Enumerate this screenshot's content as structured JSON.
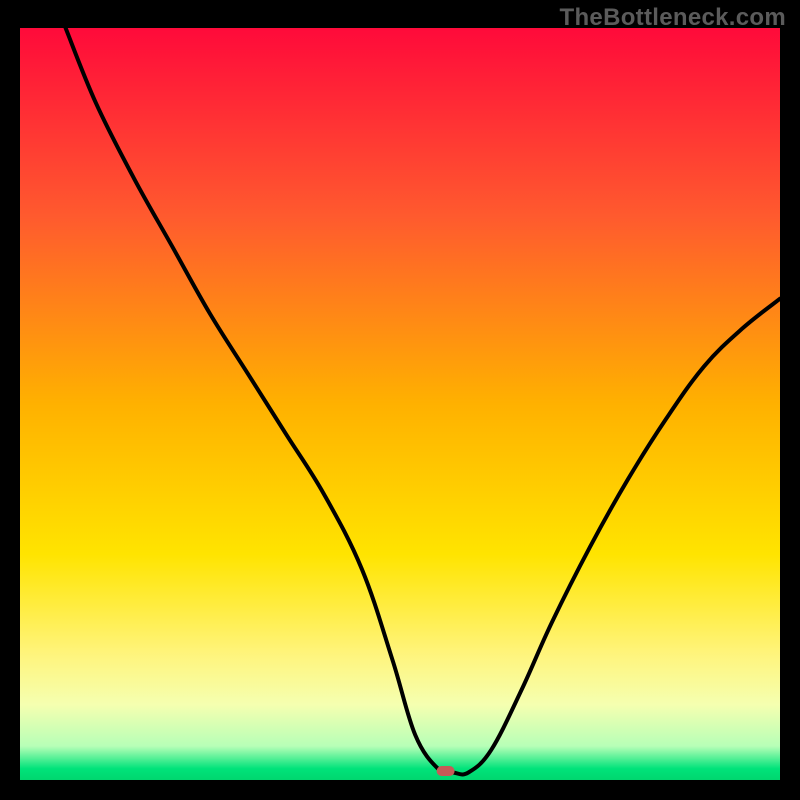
{
  "watermark": "TheBottleneck.com",
  "chart_data": {
    "type": "line",
    "title": "",
    "xlabel": "",
    "ylabel": "",
    "xlim": [
      0,
      100
    ],
    "ylim": [
      0,
      100
    ],
    "grid": false,
    "legend": false,
    "background_gradient": {
      "stops": [
        {
          "pos": 0.0,
          "color": "#ff0a3a"
        },
        {
          "pos": 0.25,
          "color": "#ff5a2e"
        },
        {
          "pos": 0.5,
          "color": "#ffb100"
        },
        {
          "pos": 0.7,
          "color": "#ffe400"
        },
        {
          "pos": 0.83,
          "color": "#fff47a"
        },
        {
          "pos": 0.9,
          "color": "#f5ffb0"
        },
        {
          "pos": 0.955,
          "color": "#b7ffb7"
        },
        {
          "pos": 0.985,
          "color": "#00e37a"
        },
        {
          "pos": 1.0,
          "color": "#00d66f"
        }
      ]
    },
    "series": [
      {
        "name": "bottleneck-curve",
        "color": "#000000",
        "x": [
          6,
          10,
          15,
          20,
          25,
          30,
          35,
          40,
          45,
          49,
          52,
          55,
          57,
          59,
          62,
          66,
          70,
          75,
          80,
          85,
          90,
          95,
          100
        ],
        "y": [
          100,
          90,
          80,
          71,
          62,
          54,
          46,
          38,
          28,
          16,
          6,
          1.5,
          1.0,
          1.0,
          4,
          12,
          21,
          31,
          40,
          48,
          55,
          60,
          64
        ]
      }
    ],
    "marker": {
      "name": "min-marker",
      "x": 56,
      "y": 1.2,
      "color": "#c65a57",
      "rx": 9,
      "ry": 5
    }
  }
}
